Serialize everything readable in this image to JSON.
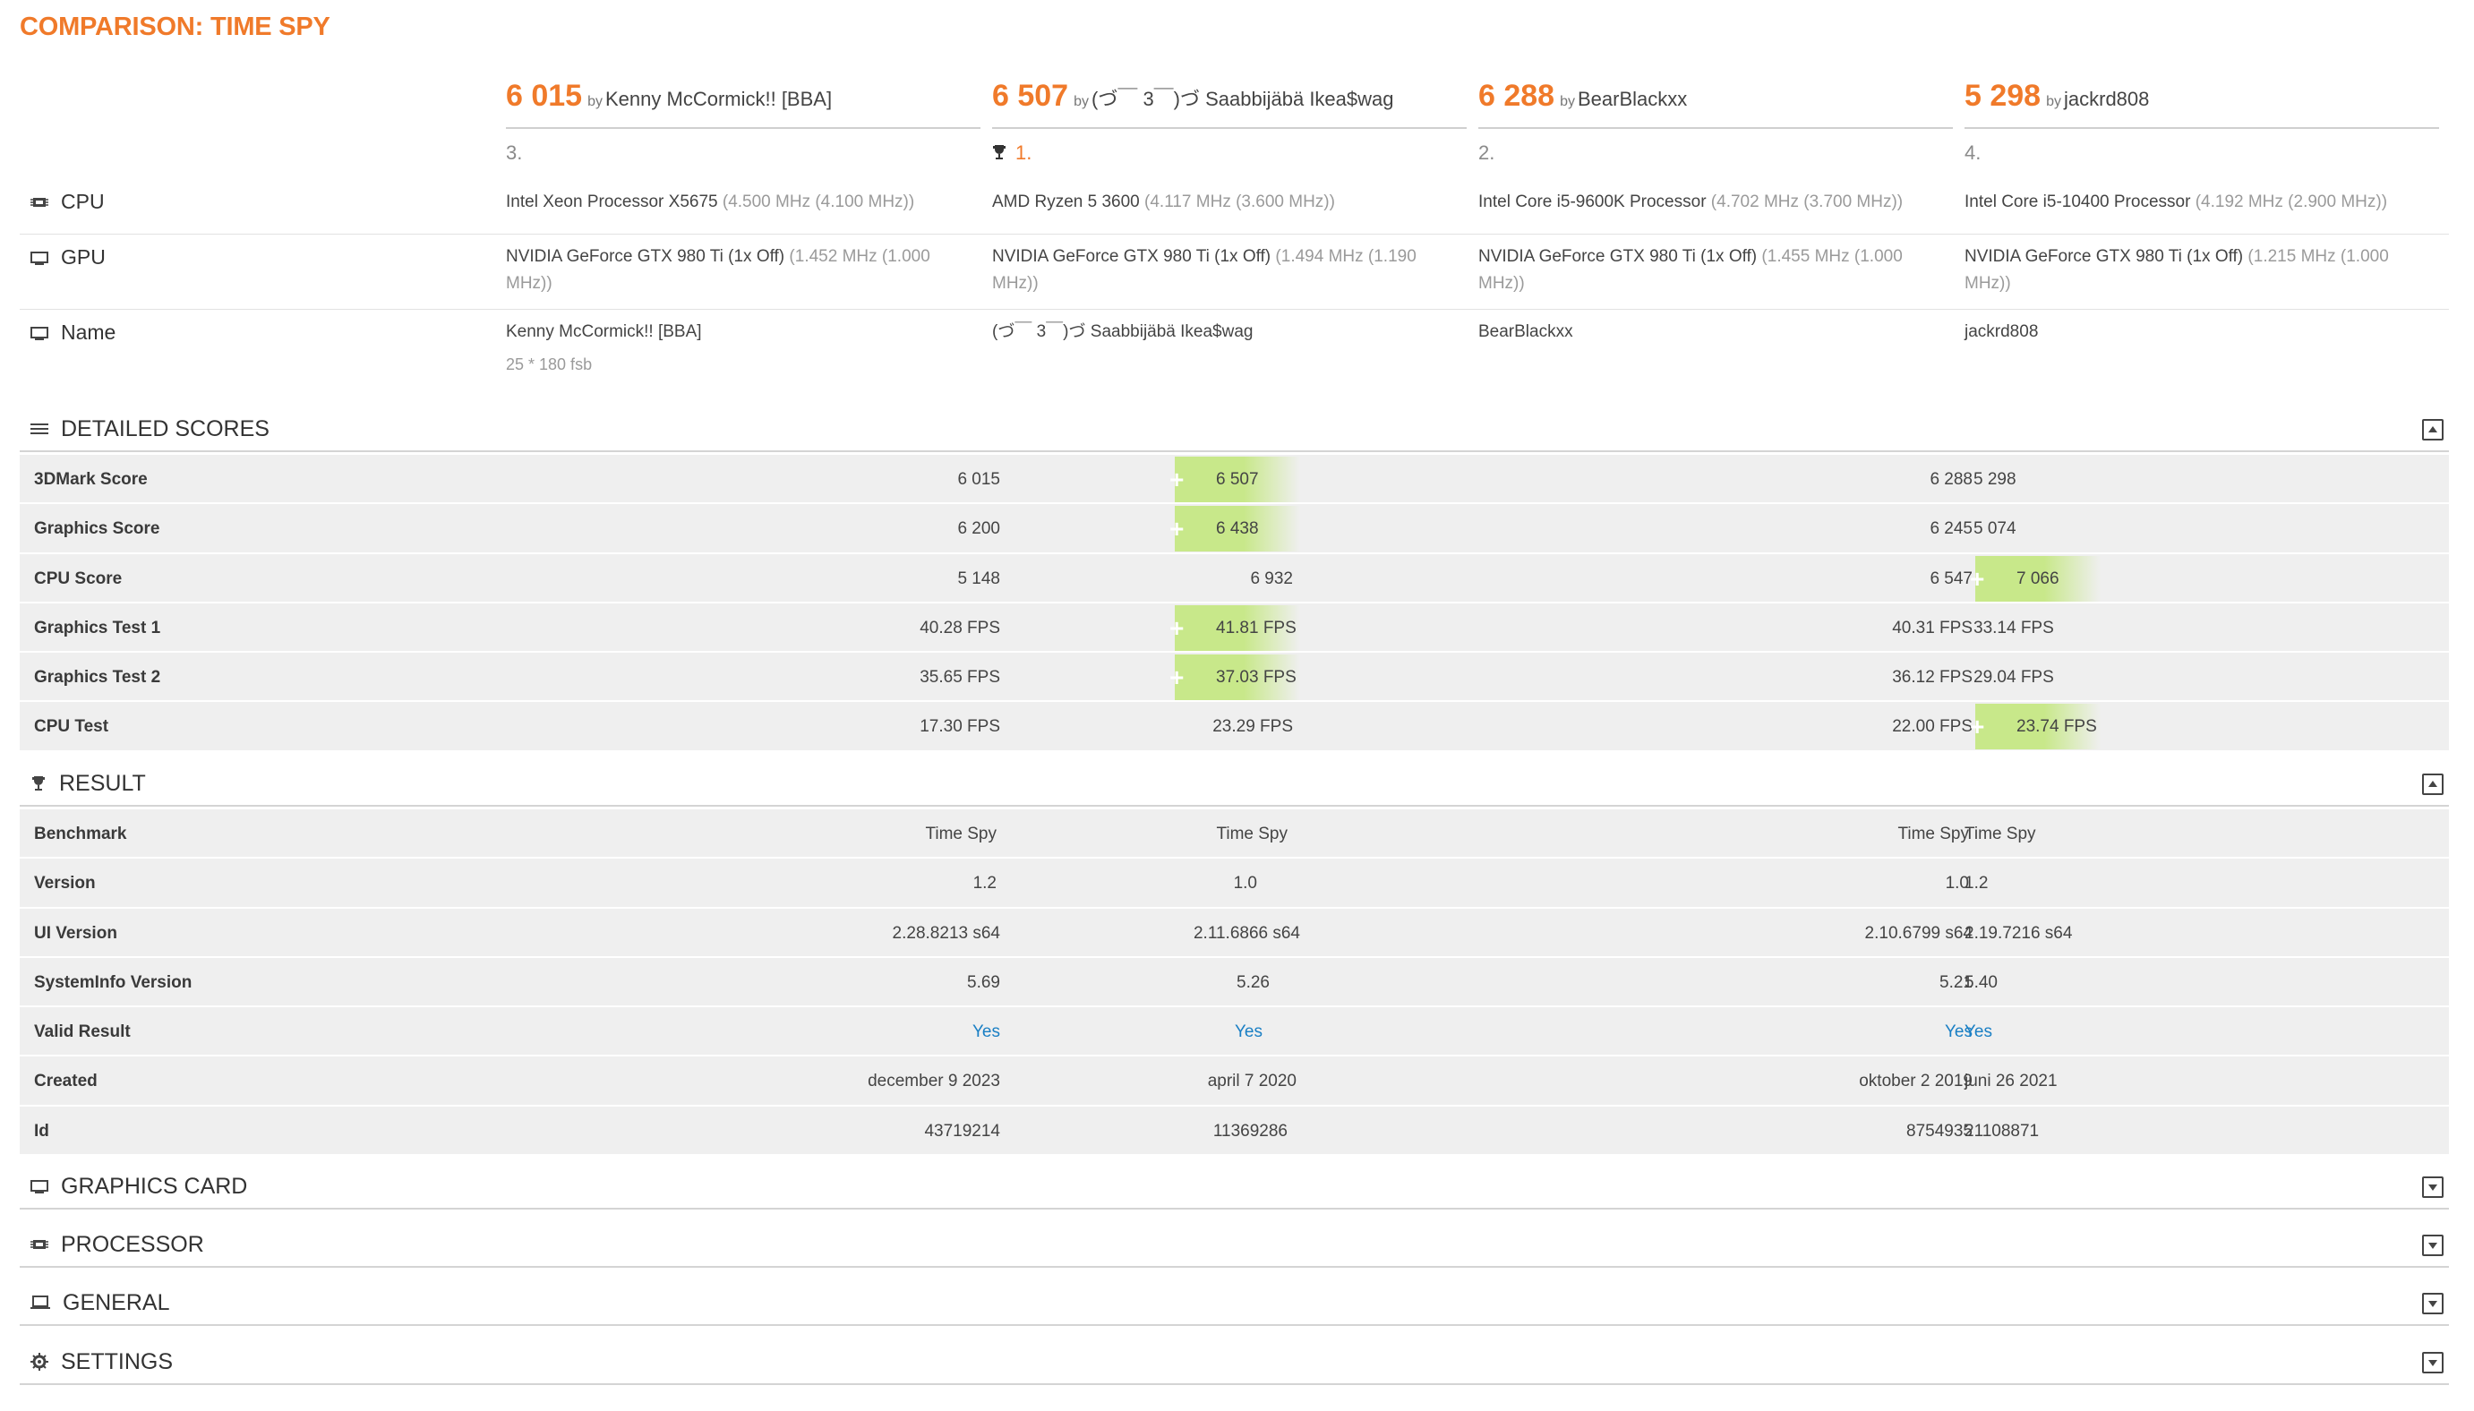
{
  "page_title": "COMPARISON: TIME SPY",
  "by_word": "by",
  "entries": [
    {
      "score": "6 015",
      "name": "Kenny McCormick!! [BBA]",
      "rank": "3."
    },
    {
      "score": "6 507",
      "name": "(づ￣ 3￣)づ Saabbijäbä Ikea$wag",
      "rank": "1."
    },
    {
      "score": "6 288",
      "name": "BearBlackxx",
      "rank": "2."
    },
    {
      "score": "5 298",
      "name": "jackrd808",
      "rank": "4."
    }
  ],
  "spec_labels": {
    "cpu": "CPU",
    "gpu": "GPU",
    "name": "Name"
  },
  "cpu": [
    {
      "model": "Intel Xeon Processor X5675",
      "clock": "(4.500 MHz (4.100 MHz))"
    },
    {
      "model": "AMD Ryzen 5 3600",
      "clock": "(4.117 MHz (3.600 MHz))"
    },
    {
      "model": "Intel Core i5-9600K Processor",
      "clock": "(4.702 MHz (3.700 MHz))"
    },
    {
      "model": "Intel Core i5-10400 Processor",
      "clock": "(4.192 MHz (2.900 MHz))"
    }
  ],
  "gpu": [
    {
      "model": "NVIDIA GeForce GTX 980 Ti (1x Off)",
      "clock": "(1.452 MHz (1.000 MHz))"
    },
    {
      "model": "NVIDIA GeForce GTX 980 Ti (1x Off)",
      "clock": "(1.494 MHz (1.190 MHz))"
    },
    {
      "model": "NVIDIA GeForce GTX 980 Ti (1x Off)",
      "clock": "(1.455 MHz (1.000 MHz))"
    },
    {
      "model": "NVIDIA GeForce GTX 980 Ti (1x Off)",
      "clock": "(1.215 MHz (1.000 MHz))"
    }
  ],
  "names": [
    {
      "name": "Kenny McCormick!! [BBA]",
      "note": "25 * 180 fsb"
    },
    {
      "name": "(づ￣ 3￣)づ Saabbijäbä Ikea$wag",
      "note": ""
    },
    {
      "name": "BearBlackxx",
      "note": ""
    },
    {
      "name": "jackrd808",
      "note": ""
    }
  ],
  "sections": {
    "detailed_scores": "DETAILED SCORES",
    "result": "RESULT",
    "graphics_card": "GRAPHICS CARD",
    "processor": "PROCESSOR",
    "general": "GENERAL",
    "settings": "SETTINGS"
  },
  "detailed_scores": [
    {
      "label": "3DMark Score",
      "values": [
        "6 015",
        "6 507",
        "6 288",
        "5 298"
      ],
      "best": 1
    },
    {
      "label": "Graphics Score",
      "values": [
        "6 200",
        "6 438",
        "6 245",
        "5 074"
      ],
      "best": 1
    },
    {
      "label": "CPU Score",
      "values": [
        "5 148",
        "6 932",
        "6 547",
        "7 066"
      ],
      "best": 3
    },
    {
      "label": "Graphics Test 1",
      "values": [
        "40.28 FPS",
        "41.81 FPS",
        "40.31 FPS",
        "33.14 FPS"
      ],
      "best": 1
    },
    {
      "label": "Graphics Test 2",
      "values": [
        "35.65 FPS",
        "37.03 FPS",
        "36.12 FPS",
        "29.04 FPS"
      ],
      "best": 1
    },
    {
      "label": "CPU Test",
      "values": [
        "17.30 FPS",
        "23.29 FPS",
        "22.00 FPS",
        "23.74 FPS"
      ],
      "best": 3
    }
  ],
  "result": [
    {
      "label": "Benchmark",
      "values": [
        "Time Spy",
        "Time Spy",
        "Time Spy",
        "Time Spy"
      ]
    },
    {
      "label": "Version",
      "values": [
        "1.2",
        "1.0",
        "1.0",
        "1.2"
      ]
    },
    {
      "label": "UI Version",
      "values": [
        "2.28.8213 s64",
        "2.11.6866 s64",
        "2.10.6799 s64",
        "2.19.7216 s64"
      ]
    },
    {
      "label": "SystemInfo Version",
      "values": [
        "5.69",
        "5.26",
        "5.21",
        "5.40"
      ]
    },
    {
      "label": "Valid Result",
      "values": [
        "Yes",
        "Yes",
        "Yes",
        "Yes"
      ]
    },
    {
      "label": "Created",
      "values": [
        "december 9 2023",
        "april 7 2020",
        "oktober 2 2019",
        "juni 26 2021"
      ]
    },
    {
      "label": "Id",
      "values": [
        "43719214",
        "11369286",
        "8754935",
        "21108871"
      ]
    }
  ],
  "colors": {
    "accent": "#f07a2a",
    "best_highlight": "#c8e88a",
    "link": "#1a7fc4"
  }
}
